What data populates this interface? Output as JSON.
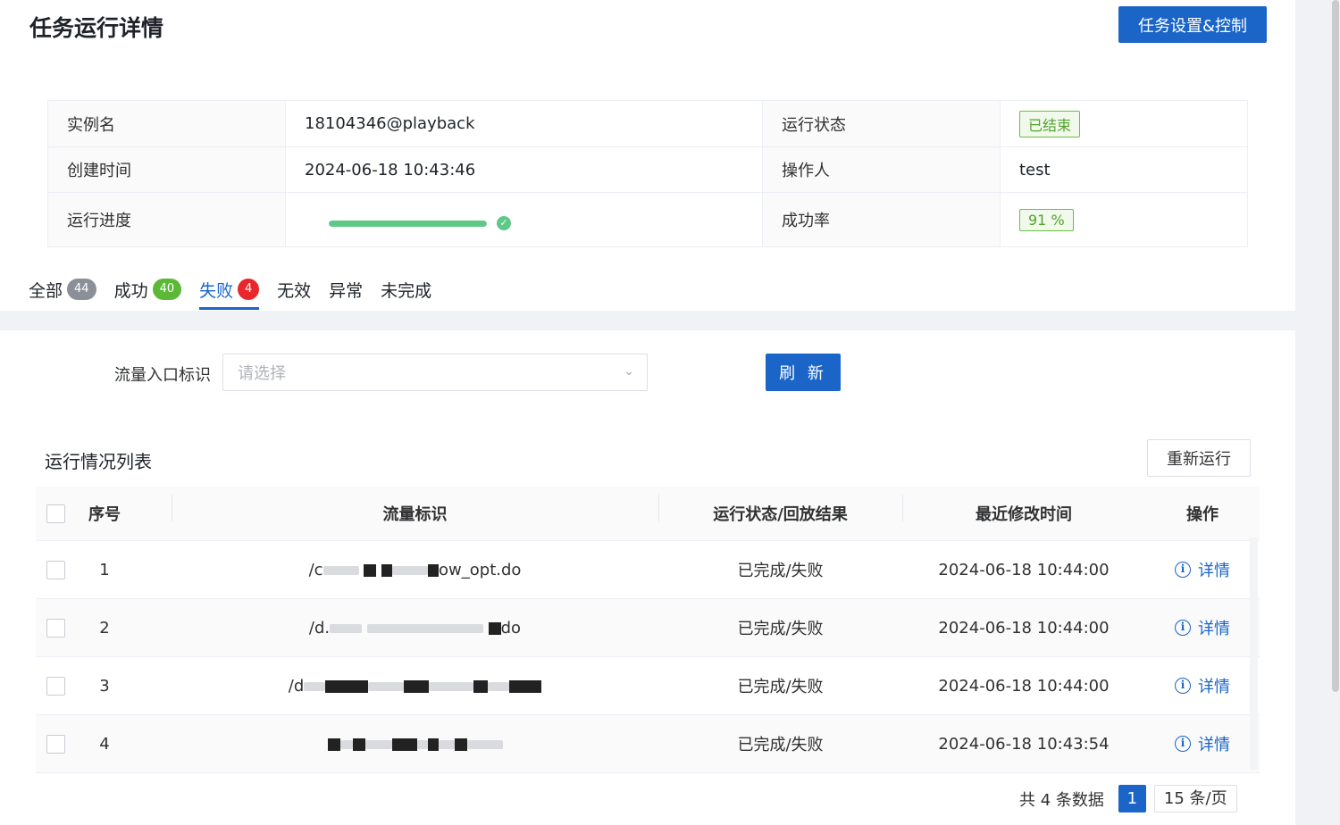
{
  "header": {
    "title": "任务运行详情",
    "settings_button": "任务设置&控制"
  },
  "info": {
    "instance_label": "实例名",
    "instance_value": "18104346@playback",
    "status_label": "运行状态",
    "status_value": "已结束",
    "created_label": "创建时间",
    "created_value": "2024-06-18 10:43:46",
    "operator_label": "操作人",
    "operator_value": "test",
    "progress_label": "运行进度",
    "progress_percent": 100,
    "success_rate_label": "成功率",
    "success_rate_value": "91 %"
  },
  "tabs": [
    {
      "label": "全部",
      "count": "44"
    },
    {
      "label": "成功",
      "count": "40"
    },
    {
      "label": "失败",
      "count": "4"
    },
    {
      "label": "无效"
    },
    {
      "label": "异常"
    },
    {
      "label": "未完成"
    }
  ],
  "filter": {
    "label": "流量入口标识",
    "placeholder": "请选择",
    "refresh_button": "刷 新"
  },
  "list": {
    "title": "运行情况列表",
    "rerun_button": "重新运行",
    "columns": {
      "index": "序号",
      "flow": "流量标识",
      "status": "运行状态/回放结果",
      "time": "最近修改时间",
      "op": "操作"
    },
    "rows": [
      {
        "index": "1",
        "flow_prefix": "/c",
        "flow_suffix": "ow_opt.do",
        "status": "已完成/失败",
        "time": "2024-06-18 10:44:00",
        "op": "详情"
      },
      {
        "index": "2",
        "flow_prefix": "/d.",
        "flow_suffix": "do",
        "status": "已完成/失败",
        "time": "2024-06-18 10:44:00",
        "op": "详情"
      },
      {
        "index": "3",
        "flow_prefix": "/d",
        "flow_suffix": "",
        "status": "已完成/失败",
        "time": "2024-06-18 10:44:00",
        "op": "详情"
      },
      {
        "index": "4",
        "flow_prefix": "",
        "flow_suffix": "",
        "status": "已完成/失败",
        "time": "2024-06-18 10:43:54",
        "op": "详情"
      }
    ]
  },
  "pagination": {
    "total": "共 4 条数据",
    "current_page": "1",
    "page_size": "15 条/页"
  },
  "colors": {
    "primary": "#1a65c7",
    "success": "#5cb837",
    "danger": "#e8262b",
    "progress": "#5fc887"
  }
}
